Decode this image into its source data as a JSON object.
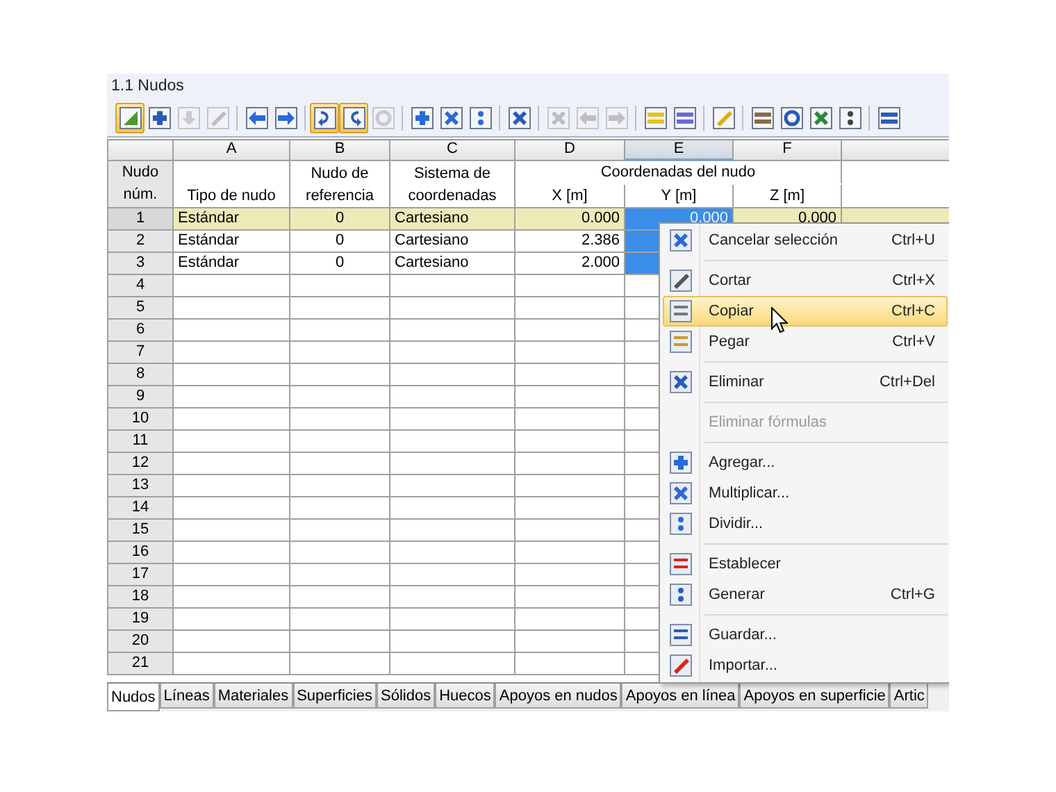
{
  "panel": {
    "title": "1.1 Nudos"
  },
  "toolbar": [
    [
      {
        "pressed": true,
        "disabled": false
      },
      {
        "pressed": false,
        "disabled": false
      },
      {
        "pressed": false,
        "disabled": true
      },
      {
        "pressed": false,
        "disabled": true
      }
    ],
    [
      {
        "pressed": false,
        "disabled": false
      },
      {
        "pressed": false,
        "disabled": false
      }
    ],
    [
      {
        "pressed": true,
        "disabled": false
      },
      {
        "pressed": true,
        "disabled": false
      },
      {
        "pressed": false,
        "disabled": true
      }
    ],
    [
      {
        "pressed": false,
        "disabled": false
      },
      {
        "pressed": false,
        "disabled": false
      },
      {
        "pressed": false,
        "disabled": false
      }
    ],
    [
      {
        "pressed": false,
        "disabled": false
      }
    ],
    [
      {
        "pressed": false,
        "disabled": true
      },
      {
        "pressed": false,
        "disabled": true
      },
      {
        "pressed": false,
        "disabled": true
      }
    ],
    [
      {
        "pressed": false,
        "disabled": false
      },
      {
        "pressed": false,
        "disabled": false
      }
    ],
    [
      {
        "pressed": false,
        "disabled": false
      }
    ],
    [
      {
        "pressed": false,
        "disabled": false
      },
      {
        "pressed": false,
        "disabled": false
      },
      {
        "pressed": false,
        "disabled": false
      },
      {
        "pressed": false,
        "disabled": false
      }
    ],
    [
      {
        "pressed": false,
        "disabled": false
      }
    ]
  ],
  "table": {
    "row_header": [
      "Nudo",
      "núm."
    ],
    "group_header": "Coordenadas del nudo",
    "columns": [
      {
        "letter": "A",
        "kind": "text",
        "heading": [
          "Tipo de nudo"
        ],
        "selected": false
      },
      {
        "letter": "B",
        "kind": "ref",
        "heading": [
          "Nudo de",
          "referencia"
        ],
        "selected": false
      },
      {
        "letter": "C",
        "kind": "combo",
        "heading": [
          "Sistema de",
          "coordenadas"
        ],
        "selected": false
      },
      {
        "letter": "D",
        "kind": "coord",
        "heading": [
          "X [m]"
        ],
        "selected": false
      },
      {
        "letter": "E",
        "kind": "coord",
        "heading": [
          "Y [m]"
        ],
        "selected": true
      },
      {
        "letter": "F",
        "kind": "coord",
        "heading": [
          "Z [m]"
        ],
        "selected": false
      }
    ],
    "rows": [
      {
        "number": "1",
        "current": true,
        "cells": [
          {
            "text": "Estándar",
            "selected": false
          },
          {
            "text": "0",
            "selected": false
          },
          {
            "text": "Cartesiano",
            "selected": false
          },
          {
            "text": "0.000",
            "selected": false
          },
          {
            "text": "0.000",
            "selected": true
          },
          {
            "text": "0.000",
            "selected": false
          }
        ]
      },
      {
        "number": "2",
        "current": false,
        "cells": [
          {
            "text": "Estándar",
            "selected": false
          },
          {
            "text": "0",
            "selected": false
          },
          {
            "text": "Cartesiano",
            "selected": false
          },
          {
            "text": "2.386",
            "selected": false
          },
          {
            "selected": true
          }
        ]
      },
      {
        "number": "3",
        "current": false,
        "cells": [
          {
            "text": "Estándar",
            "selected": false
          },
          {
            "text": "0",
            "selected": false
          },
          {
            "text": "Cartesiano",
            "selected": false
          },
          {
            "text": "2.000",
            "selected": false
          },
          {
            "selected": true
          }
        ]
      },
      {
        "number": "4",
        "current": false
      },
      {
        "number": "5",
        "current": false
      },
      {
        "number": "6",
        "current": false
      },
      {
        "number": "7",
        "current": false
      },
      {
        "number": "8",
        "current": false
      },
      {
        "number": "9",
        "current": false
      },
      {
        "number": "10",
        "current": false
      },
      {
        "number": "11",
        "current": false
      },
      {
        "number": "12",
        "current": false
      },
      {
        "number": "13",
        "current": false
      },
      {
        "number": "14",
        "current": false
      },
      {
        "number": "15",
        "current": false
      },
      {
        "number": "16",
        "current": false
      },
      {
        "number": "17",
        "current": false
      },
      {
        "number": "18",
        "current": false
      },
      {
        "number": "19",
        "current": false
      },
      {
        "number": "20",
        "current": false
      },
      {
        "number": "21",
        "current": false
      }
    ]
  },
  "tabs": [
    {
      "label": "Nudos",
      "selected": true
    },
    {
      "label": "Líneas",
      "selected": false
    },
    {
      "label": "Materiales",
      "selected": false
    },
    {
      "label": "Superficies",
      "selected": false
    },
    {
      "label": "Sólidos",
      "selected": false
    },
    {
      "label": "Huecos",
      "selected": false
    },
    {
      "label": "Apoyos en nudos",
      "selected": false
    },
    {
      "label": "Apoyos en línea",
      "selected": false
    },
    {
      "label": "Apoyos en superficie",
      "selected": false
    },
    {
      "label": "Artic",
      "selected": false
    }
  ],
  "context_menu": [
    {
      "kind": "item",
      "label": "Cancelar selección",
      "shortcut": "Ctrl+U",
      "selected": false,
      "disabled": false
    },
    {
      "kind": "separator"
    },
    {
      "kind": "item",
      "label": "Cortar",
      "shortcut": "Ctrl+X",
      "selected": false,
      "disabled": false
    },
    {
      "kind": "item",
      "label": "Copiar",
      "shortcut": "Ctrl+C",
      "selected": true,
      "disabled": false
    },
    {
      "kind": "item",
      "label": "Pegar",
      "shortcut": "Ctrl+V",
      "selected": false,
      "disabled": false
    },
    {
      "kind": "separator"
    },
    {
      "kind": "item",
      "label": "Eliminar",
      "shortcut": "Ctrl+Del",
      "selected": false,
      "disabled": false
    },
    {
      "kind": "separator"
    },
    {
      "kind": "item",
      "label": "Eliminar fórmulas",
      "selected": false,
      "disabled": true
    },
    {
      "kind": "separator"
    },
    {
      "kind": "item",
      "label": "Agregar...",
      "selected": false,
      "disabled": false
    },
    {
      "kind": "item",
      "label": "Multiplicar...",
      "selected": false,
      "disabled": false
    },
    {
      "kind": "item",
      "label": "Dividir...",
      "selected": false,
      "disabled": false
    },
    {
      "kind": "separator"
    },
    {
      "kind": "item",
      "label": "Establecer",
      "selected": false,
      "disabled": false
    },
    {
      "kind": "item",
      "label": "Generar",
      "shortcut": "Ctrl+G",
      "selected": false,
      "disabled": false
    },
    {
      "kind": "separator"
    },
    {
      "kind": "item",
      "label": "Guardar...",
      "selected": false,
      "disabled": false
    },
    {
      "kind": "item",
      "label": "Importar...",
      "selected": false,
      "disabled": false
    }
  ]
}
